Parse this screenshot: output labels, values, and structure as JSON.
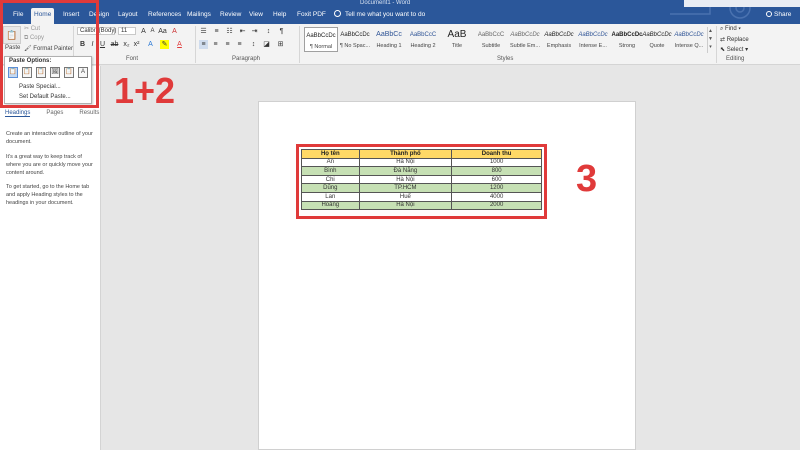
{
  "window": {
    "title": "Document1 - Word"
  },
  "tabs": [
    "File",
    "Home",
    "Insert",
    "Design",
    "Layout",
    "References",
    "Mailings",
    "Review",
    "View",
    "Help",
    "Foxit PDF"
  ],
  "tell_me": "Tell me what you want to do",
  "share": "Share",
  "clipboard": {
    "paste": "Paste",
    "cut": "Cut",
    "copy": "Copy",
    "format_painter": "Format Painter"
  },
  "font": {
    "name": "Calibri (Body)",
    "size": "11",
    "group_label": "Font"
  },
  "paragraph": {
    "group_label": "Paragraph"
  },
  "styles": {
    "group_label": "Styles",
    "items": [
      {
        "sample": "AaBbCcDc",
        "name": "¶ Normal"
      },
      {
        "sample": "AaBbCcDc",
        "name": "¶ No Spac..."
      },
      {
        "sample": "AaBbCc",
        "name": "Heading 1"
      },
      {
        "sample": "AaBbCcC",
        "name": "Heading 2"
      },
      {
        "sample": "AaB",
        "name": "Title"
      },
      {
        "sample": "AaBbCcC",
        "name": "Subtitle"
      },
      {
        "sample": "AaBbCcDc",
        "name": "Subtle Em..."
      },
      {
        "sample": "AaBbCcDc",
        "name": "Emphasis"
      },
      {
        "sample": "AaBbCcDc",
        "name": "Intense E..."
      },
      {
        "sample": "AaBbCcDc",
        "name": "Strong"
      },
      {
        "sample": "AaBbCcDc",
        "name": "Quote"
      },
      {
        "sample": "AaBbCcDc",
        "name": "Intense Q..."
      }
    ]
  },
  "editing": {
    "group_label": "Editing",
    "find": "Find",
    "replace": "Replace",
    "select": "Select"
  },
  "paste_menu": {
    "title": "Paste Options:",
    "paste_special": "Paste Special...",
    "set_default": "Set Default Paste..."
  },
  "nav_pane": {
    "tabs": [
      "Headings",
      "Pages",
      "Results"
    ],
    "p1": "Create an interactive outline of your document.",
    "p2": "It's a great way to keep track of where you are or quickly move your content around.",
    "p3": "To get started, go to the Home tab and apply Heading styles to the headings in your document."
  },
  "table": {
    "headers": [
      "Họ tên",
      "Thành phố",
      "Doanh thu"
    ],
    "rows": [
      [
        "An",
        "Hà Nội",
        "1000"
      ],
      [
        "Bình",
        "Đà Nẵng",
        "800"
      ],
      [
        "Chi",
        "Hà Nội",
        "600"
      ],
      [
        "Dũng",
        "TP.HCM",
        "1200"
      ],
      [
        "Lan",
        "Huế",
        "4000"
      ],
      [
        "Hoàng",
        "Hà Nội",
        "2000"
      ]
    ]
  },
  "annotations": {
    "label_1": "1+2",
    "label_2": "3",
    "color": "#e03a3a"
  },
  "colors": {
    "word_blue": "#2b579a",
    "header_yellow": "#ffd966",
    "row_green": "#c6e0b4"
  }
}
